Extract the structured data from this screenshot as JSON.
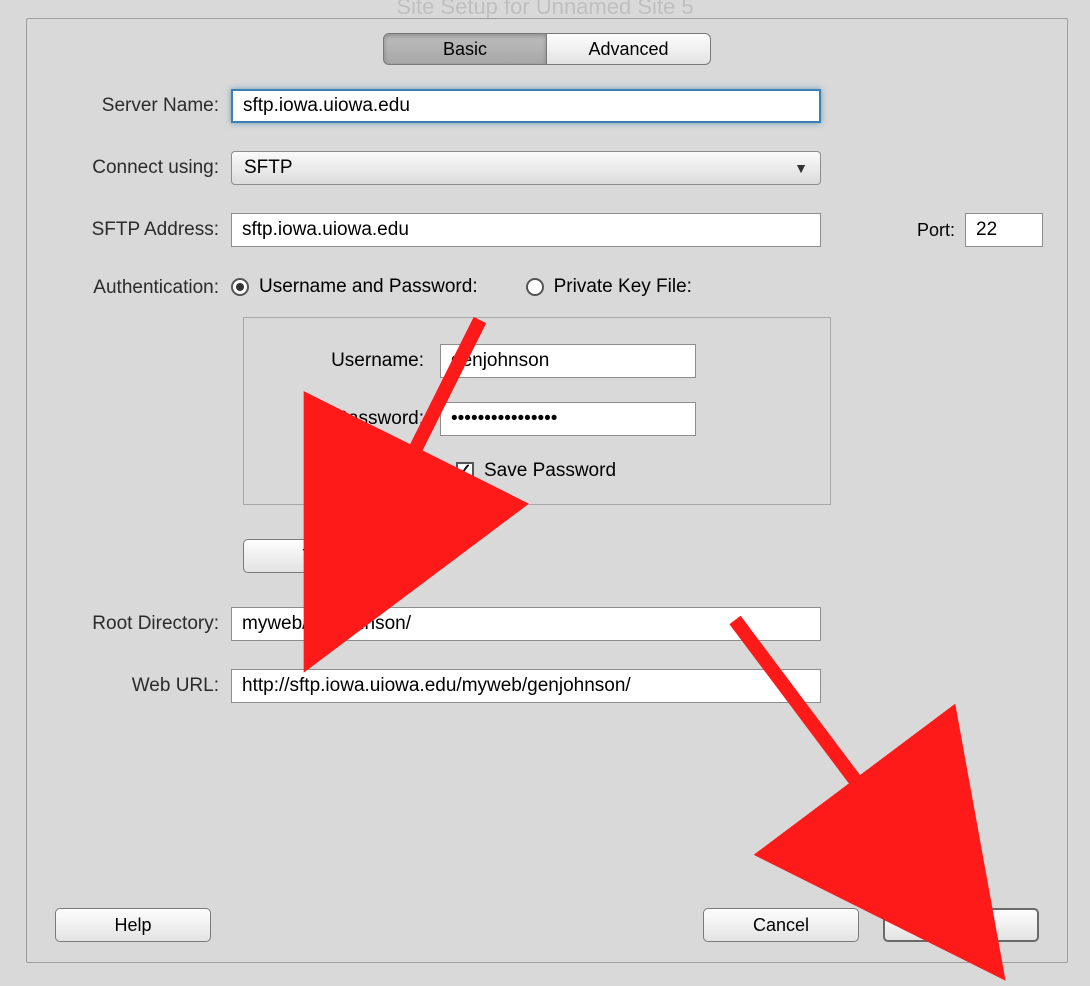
{
  "window_title": "Site Setup for Unnamed Site 5",
  "tabs": {
    "basic": "Basic",
    "advanced": "Advanced"
  },
  "labels": {
    "server_name": "Server Name:",
    "connect_using": "Connect using:",
    "sftp_address": "SFTP Address:",
    "port": "Port:",
    "authentication": "Authentication:",
    "username": "Username:",
    "password": "Password:",
    "save_password": "Save Password",
    "root_directory": "Root Directory:",
    "web_url": "Web URL:"
  },
  "auth_options": {
    "user_pass": "Username and Password:",
    "private_key": "Private Key File:"
  },
  "buttons": {
    "test": "Test",
    "help": "Help",
    "cancel": "Cancel",
    "save": "Save"
  },
  "values": {
    "server_name": "sftp.iowa.uiowa.edu",
    "connect_using": "SFTP",
    "sftp_address": "sftp.iowa.uiowa.edu",
    "port": "22",
    "username": "genjohnson",
    "password": "••••••••••••••••",
    "root_directory": "myweb/genjohnson/",
    "web_url": "http://sftp.iowa.uiowa.edu/myweb/genjohnson/"
  }
}
